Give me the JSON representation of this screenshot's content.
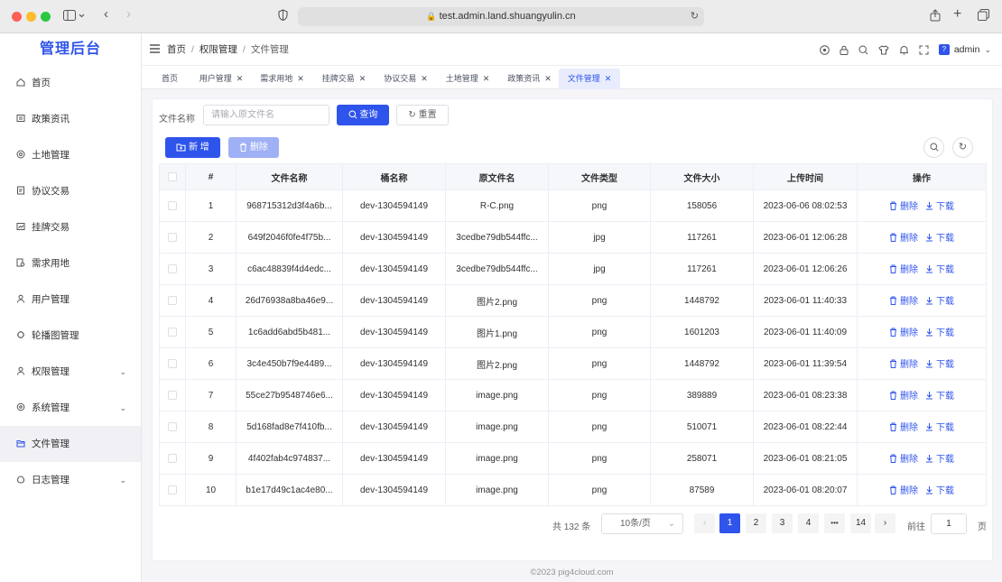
{
  "browser": {
    "url": "test.admin.land.shuangyulin.cn"
  },
  "app": {
    "title": "管理后台"
  },
  "sidebar": {
    "items": [
      {
        "label": "首页",
        "icon": "home-icon"
      },
      {
        "label": "政策资讯",
        "icon": "news-icon"
      },
      {
        "label": "土地管理",
        "icon": "land-icon"
      },
      {
        "label": "协议交易",
        "icon": "contract-icon"
      },
      {
        "label": "挂牌交易",
        "icon": "listing-icon"
      },
      {
        "label": "需求用地",
        "icon": "demand-icon"
      },
      {
        "label": "用户管理",
        "icon": "user-icon"
      },
      {
        "label": "轮播图管理",
        "icon": "carousel-icon"
      },
      {
        "label": "权限管理",
        "icon": "permission-icon",
        "expandable": true
      },
      {
        "label": "系统管理",
        "icon": "system-icon",
        "expandable": true
      },
      {
        "label": "文件管理",
        "icon": "file-icon",
        "active": true
      },
      {
        "label": "日志管理",
        "icon": "log-icon",
        "expandable": true
      }
    ]
  },
  "header": {
    "breadcrumb": [
      "首页",
      "权限管理",
      "文件管理"
    ],
    "separator": "/",
    "user": "admin"
  },
  "tabs": [
    {
      "label": "首页",
      "closable": false
    },
    {
      "label": "用户管理",
      "closable": true
    },
    {
      "label": "需求用地",
      "closable": true
    },
    {
      "label": "挂牌交易",
      "closable": true
    },
    {
      "label": "协议交易",
      "closable": true
    },
    {
      "label": "土地管理",
      "closable": true
    },
    {
      "label": "政策资讯",
      "closable": true
    },
    {
      "label": "文件管理",
      "closable": true,
      "active": true
    }
  ],
  "search": {
    "label": "文件名称",
    "placeholder": "请输入原文件名",
    "query_label": "查询",
    "reset_label": "重置"
  },
  "toolbar": {
    "add_label": "新 增",
    "delete_label": "删除"
  },
  "table": {
    "columns": [
      "#",
      "文件名称",
      "桶名称",
      "原文件名",
      "文件类型",
      "文件大小",
      "上传时间",
      "操作"
    ],
    "action_delete": "删除",
    "action_download": "下载",
    "rows": [
      {
        "no": "1",
        "name": "968715312d3f4a6b...",
        "bucket": "dev-1304594149",
        "orig": "R-C.png",
        "type": "png",
        "size": "158056",
        "time": "2023-06-06 08:02:53"
      },
      {
        "no": "2",
        "name": "649f2046f0fe4f75b...",
        "bucket": "dev-1304594149",
        "orig": "3cedbe79db544ffc...",
        "type": "jpg",
        "size": "117261",
        "time": "2023-06-01 12:06:28"
      },
      {
        "no": "3",
        "name": "c6ac48839f4d4edc...",
        "bucket": "dev-1304594149",
        "orig": "3cedbe79db544ffc...",
        "type": "jpg",
        "size": "117261",
        "time": "2023-06-01 12:06:26"
      },
      {
        "no": "4",
        "name": "26d76938a8ba46e9...",
        "bucket": "dev-1304594149",
        "orig": "图片2.png",
        "type": "png",
        "size": "1448792",
        "time": "2023-06-01 11:40:33"
      },
      {
        "no": "5",
        "name": "1c6add6abd5b481...",
        "bucket": "dev-1304594149",
        "orig": "图片1.png",
        "type": "png",
        "size": "1601203",
        "time": "2023-06-01 11:40:09"
      },
      {
        "no": "6",
        "name": "3c4e450b7f9e4489...",
        "bucket": "dev-1304594149",
        "orig": "图片2.png",
        "type": "png",
        "size": "1448792",
        "time": "2023-06-01 11:39:54"
      },
      {
        "no": "7",
        "name": "55ce27b9548746e6...",
        "bucket": "dev-1304594149",
        "orig": "image.png",
        "type": "png",
        "size": "389889",
        "time": "2023-06-01 08:23:38"
      },
      {
        "no": "8",
        "name": "5d168fad8e7f410fb...",
        "bucket": "dev-1304594149",
        "orig": "image.png",
        "type": "png",
        "size": "510071",
        "time": "2023-06-01 08:22:44"
      },
      {
        "no": "9",
        "name": "4f402fab4c974837...",
        "bucket": "dev-1304594149",
        "orig": "image.png",
        "type": "png",
        "size": "258071",
        "time": "2023-06-01 08:21:05"
      },
      {
        "no": "10",
        "name": "b1e17d49c1ac4e80...",
        "bucket": "dev-1304594149",
        "orig": "image.png",
        "type": "png",
        "size": "87589",
        "time": "2023-06-01 08:20:07"
      }
    ]
  },
  "pagination": {
    "total_text": "共 132 条",
    "page_size": "10条/页",
    "pages": [
      "1",
      "2",
      "3",
      "4",
      "•••",
      "14"
    ],
    "current": "1",
    "goto_label": "前往",
    "goto_value": "1",
    "page_suffix": "页",
    "prev": "‹",
    "next": "›"
  },
  "footer": {
    "text": "©2023 pig4cloud.com"
  },
  "colors": {
    "primary": "#2f54eb",
    "logo": "#2f54eb"
  }
}
